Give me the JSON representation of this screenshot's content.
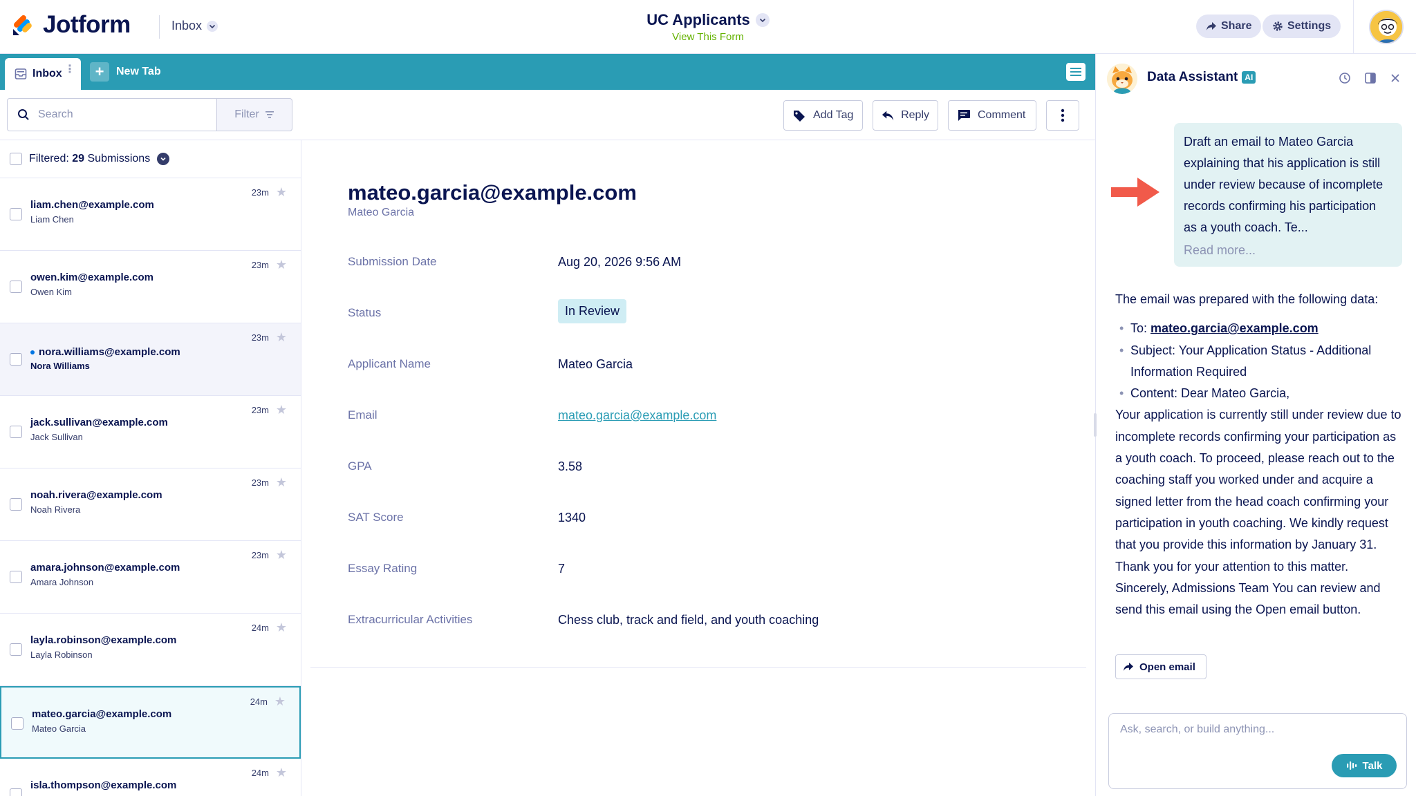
{
  "header": {
    "logo_text": "Jotform",
    "inbox_label": "Inbox",
    "form_title": "UC Applicants",
    "view_form_link": "View This Form",
    "share_label": "Share",
    "settings_label": "Settings"
  },
  "tabs": {
    "inbox_label": "Inbox",
    "new_tab_label": "New Tab"
  },
  "toolbar": {
    "search_placeholder": "Search",
    "filter_label": "Filter",
    "add_tag_label": "Add Tag",
    "reply_label": "Reply",
    "comment_label": "Comment"
  },
  "list": {
    "filtered_prefix": "Filtered:",
    "filtered_count": "29",
    "filtered_suffix": "Submissions",
    "rows": [
      {
        "email": "liam.chen@example.com",
        "name": "Liam Chen",
        "time": "23m"
      },
      {
        "email": "owen.kim@example.com",
        "name": "Owen Kim",
        "time": "23m"
      },
      {
        "email": "nora.williams@example.com",
        "name": "Nora Williams",
        "time": "23m"
      },
      {
        "email": "jack.sullivan@example.com",
        "name": "Jack Sullivan",
        "time": "23m"
      },
      {
        "email": "noah.rivera@example.com",
        "name": "Noah Rivera",
        "time": "23m"
      },
      {
        "email": "amara.johnson@example.com",
        "name": "Amara Johnson",
        "time": "23m"
      },
      {
        "email": "layla.robinson@example.com",
        "name": "Layla Robinson",
        "time": "24m"
      },
      {
        "email": "mateo.garcia@example.com",
        "name": "Mateo Garcia",
        "time": "24m"
      },
      {
        "email": "isla.thompson@example.com",
        "name": "",
        "time": "24m"
      }
    ]
  },
  "detail": {
    "email": "mateo.garcia@example.com",
    "name": "Mateo Garcia",
    "fields": [
      {
        "label": "Submission Date",
        "value": "Aug 20, 2026 9:56 AM"
      },
      {
        "label": "Status",
        "value": "In Review"
      },
      {
        "label": "Applicant Name",
        "value": "Mateo Garcia"
      },
      {
        "label": "Email",
        "value": "mateo.garcia@example.com"
      },
      {
        "label": "GPA",
        "value": "3.58"
      },
      {
        "label": "SAT Score",
        "value": "1340"
      },
      {
        "label": "Essay Rating",
        "value": "7"
      },
      {
        "label": "Extracurricular Activities",
        "value": "Chess club, track and field, and youth coaching"
      }
    ]
  },
  "assistant": {
    "title": "Data Assistant",
    "badge": "AI",
    "user_message": "Draft an email to Mateo Garcia explaining that his application is still under review because of incomplete records confirming his participation as a youth coach. Te...",
    "read_more": "Read more...",
    "intro": "The email was prepared with the following data:",
    "to_label": "To:",
    "to_value": "mateo.garcia@example.com",
    "subject_line": "Subject: Your Application Status - Additional Information Required",
    "content_line": "Content: Dear Mateo Garcia,",
    "body": "Your application is currently still under review due to incomplete records confirming your participation as a youth coach. To proceed, please reach out to the coaching staff you worked under and acquire a signed letter from the head coach confirming your participation in youth coaching. We kindly request that you provide this information by January 31. Thank you for your attention to this matter. Sincerely, Admissions Team You can review and send this email using the Open email button.",
    "open_email_label": "Open email",
    "input_placeholder": "Ask, search, or build anything...",
    "talk_label": "Talk"
  },
  "colors": {
    "navy": "#0a1551",
    "teal": "#2a9cb4",
    "green_link": "#64b200",
    "arrow_red": "#f15a4a"
  },
  "icons": [
    "jotform-logo-icon",
    "chevron-down-icon",
    "share-icon",
    "gear-icon",
    "inbox-icon",
    "plus-icon",
    "menu-icon",
    "search-icon",
    "filter-icon",
    "tag-icon",
    "reply-icon",
    "comment-icon",
    "more-vertical-icon",
    "star-icon",
    "history-icon",
    "panel-icon",
    "close-icon",
    "arrow-icon",
    "forward-icon",
    "waveform-icon"
  ]
}
